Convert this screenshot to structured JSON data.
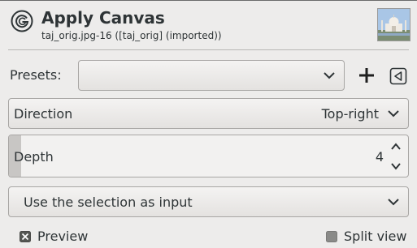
{
  "header": {
    "title": "Apply Canvas",
    "subtitle": "taj_orig.jpg-16 ([taj_orig] (imported))"
  },
  "presets": {
    "label": "Presets:",
    "selected": ""
  },
  "direction": {
    "label": "Direction",
    "value": "Top-right"
  },
  "depth": {
    "label": "Depth",
    "value": "4",
    "fill_fraction": 0.03
  },
  "input_mode": {
    "value": "Use the selection as input"
  },
  "preview": {
    "label": "Preview",
    "checked": true
  },
  "split_view": {
    "label": "Split view",
    "checked": false
  },
  "colors": {
    "background": "#edeceb",
    "text": "#2e3436",
    "border": "#a8a6a4"
  }
}
